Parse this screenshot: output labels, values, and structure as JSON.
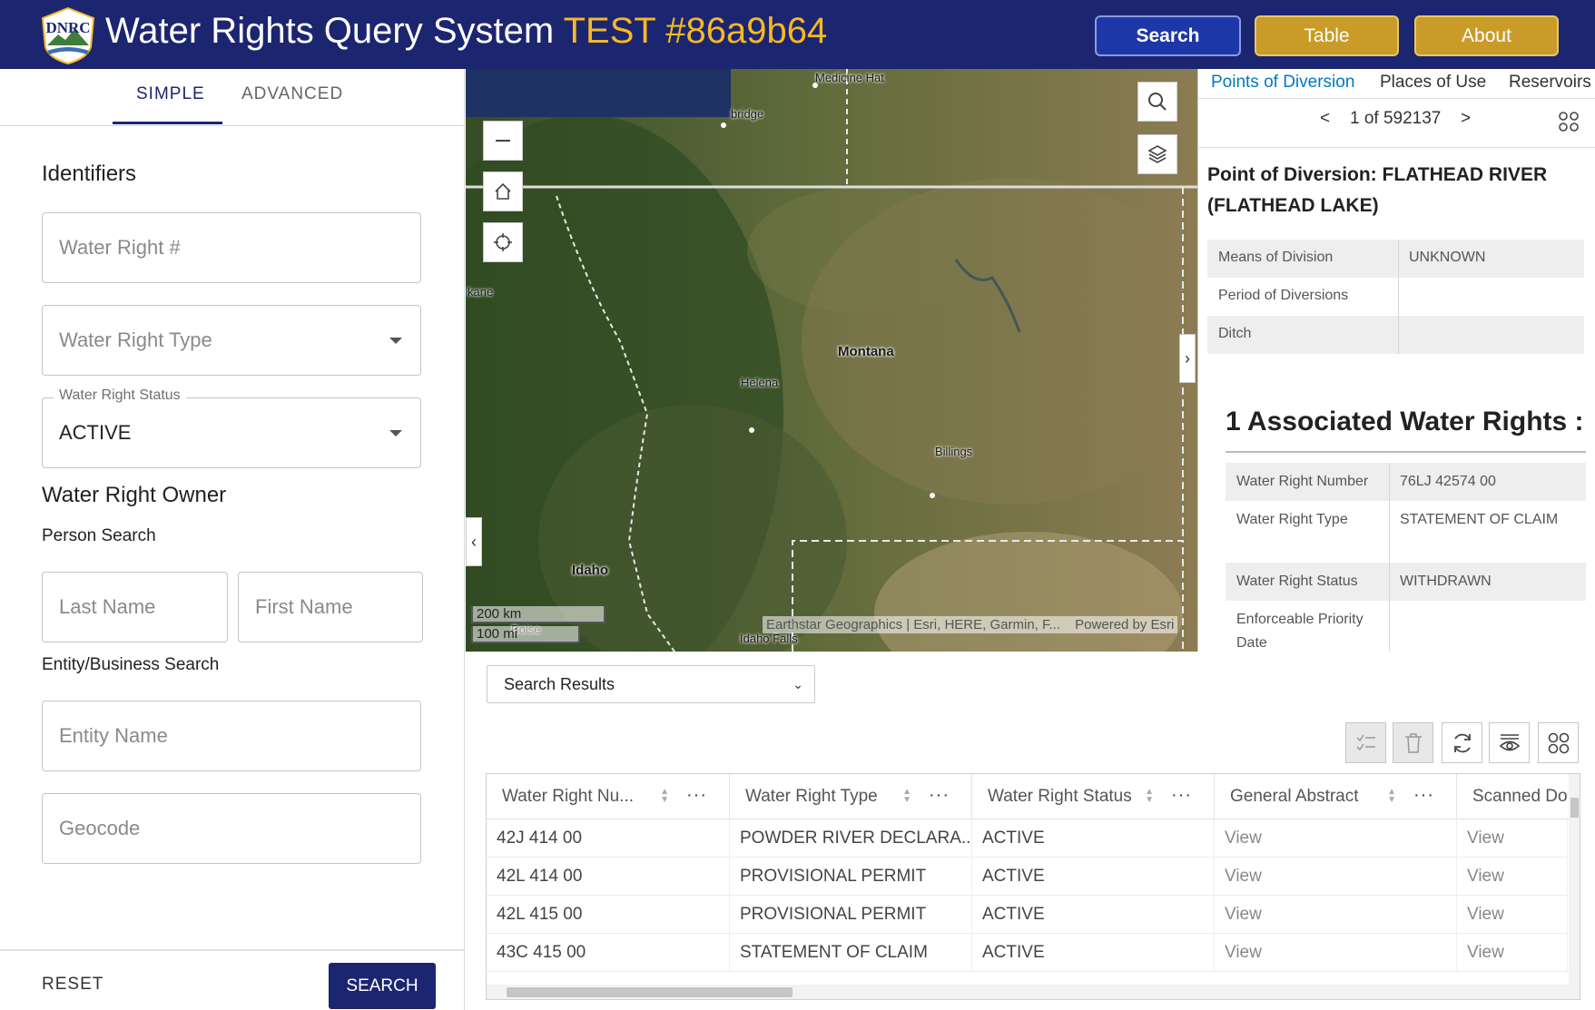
{
  "header": {
    "logo_text": "DNRC",
    "title": "Water Rights Query System",
    "test_tag": "TEST #86a9b64",
    "buttons": {
      "search": "Search",
      "table": "Table",
      "about": "About"
    }
  },
  "left_panel": {
    "tabs": [
      "SIMPLE",
      "ADVANCED"
    ],
    "active_tab": "SIMPLE",
    "identifiers_title": "Identifiers",
    "water_right_number": {
      "placeholder": "Water Right #",
      "value": ""
    },
    "water_right_type": {
      "placeholder": "Water Right Type",
      "value": ""
    },
    "water_right_status": {
      "label": "Water Right Status",
      "value": "ACTIVE"
    },
    "owner_title": "Water Right Owner",
    "person_search_label": "Person Search",
    "last_name": {
      "placeholder": "Last Name",
      "value": ""
    },
    "first_name": {
      "placeholder": "First Name",
      "value": ""
    },
    "entity_search_label": "Entity/Business Search",
    "entity_name": {
      "placeholder": "Entity Name",
      "value": ""
    },
    "geocode": {
      "placeholder": "Geocode",
      "value": ""
    },
    "reset_label": "RESET",
    "search_label": "SEARCH"
  },
  "map": {
    "labels": {
      "medicine_hat": "Medicine Hat",
      "lethbridge": "bridge",
      "spokane": "kane",
      "montana": "Montana",
      "helena": "Helena",
      "billings": "Billings",
      "idaho": "Idaho",
      "boise": "Boise",
      "idaho_falls": "Idaho Falls"
    },
    "scale_km": "200 km",
    "scale_mi": "100 mi",
    "attribution": "Earthstar Geographics | Esri, HERE, Garmin, F...",
    "powered_by": "Powered by Esri",
    "controls": [
      "zoom-out",
      "home",
      "locate",
      "search",
      "layers"
    ]
  },
  "right_panel": {
    "tabs": [
      "Points of Diversion",
      "Places of Use",
      "Reservoirs"
    ],
    "active_tab": "Points of Diversion",
    "pager": {
      "prev": "<",
      "current": "1",
      "of": "of",
      "total": "592137",
      "next": ">",
      "text": "1 of 592137"
    },
    "poi_title": "Point of Diversion: FLATHEAD RIVER (FLATHEAD LAKE)",
    "attributes": [
      {
        "key": "Means of Division",
        "value": "UNKNOWN"
      },
      {
        "key": "Period of Diversions",
        "value": ""
      },
      {
        "key": "Ditch",
        "value": ""
      }
    ],
    "associated_title": "1 Associated Water Rights :",
    "associated": [
      {
        "key": "Water Right Number",
        "value": "76LJ 42574 00"
      },
      {
        "key": "Water Right Type",
        "value": "STATEMENT OF CLAIM"
      },
      {
        "key": "Water Right Status",
        "value": "WITHDRAWN"
      },
      {
        "key": "Enforceable Priority Date",
        "value": ""
      }
    ]
  },
  "results": {
    "select_value": "Search Results",
    "columns": [
      "Water Right Nu...",
      "Water Right Type",
      "Water Right Status",
      "General Abstract",
      "Scanned Do"
    ],
    "rows": [
      [
        "42J 414 00",
        "POWDER RIVER DECLARA...",
        "ACTIVE",
        "View",
        "View"
      ],
      [
        "42L 414 00",
        "PROVISIONAL PERMIT",
        "ACTIVE",
        "View",
        "View"
      ],
      [
        "42L 415 00",
        "PROVISIONAL PERMIT",
        "ACTIVE",
        "View",
        "View"
      ],
      [
        "43C 415 00",
        "STATEMENT OF CLAIM",
        "ACTIVE",
        "View",
        "View"
      ]
    ],
    "toolbar": [
      "show-selection",
      "clear-selection",
      "refresh",
      "toggle-columns",
      "options"
    ]
  },
  "colors": {
    "header_bg": "#1c2570",
    "test_tag": "#f5b925",
    "search_button": "#1e37a8",
    "gold_button": "#c99b28",
    "active_tab_link": "#0079c1"
  }
}
